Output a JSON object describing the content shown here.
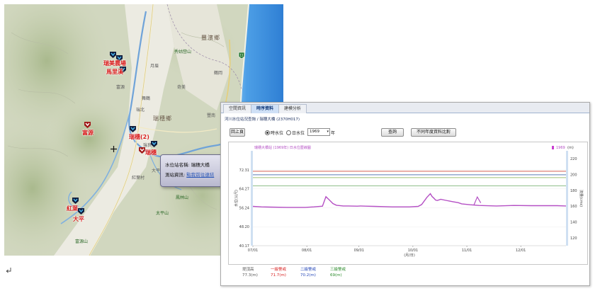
{
  "map": {
    "place_labels": [
      "豐濱鄉",
      "瑞穗鄉",
      "秀姑巒山",
      "月眉",
      "奇美",
      "紅葉村",
      "舞鶴",
      "瑞北",
      "富源",
      "大平",
      "鶴岡",
      "瑞良",
      "鳳林山",
      "太平山",
      "富源山",
      "豐南"
    ],
    "stations": [
      {
        "label": "瑞美農場",
        "name": "station-ruimei"
      },
      {
        "label": "馬里溪",
        "name": "station-mali"
      },
      {
        "label": "富源",
        "name": "station-fuyuan"
      },
      {
        "label": "瑞穗(2)",
        "name": "station-ruisui2"
      },
      {
        "label": "瑞穗",
        "name": "station-ruisui"
      },
      {
        "label": "紅葉",
        "name": "station-hongye"
      },
      {
        "label": "大平",
        "name": "station-daping"
      }
    ],
    "popup": {
      "station_label": "水位站名稱:",
      "station_value": "瑞穗大橋",
      "info_label": "測站資訊:",
      "info_link": "點我前往連結"
    },
    "highway_number": "11"
  },
  "panel": {
    "tabs": [
      {
        "label": "空間資訊",
        "active": false
      },
      {
        "label": "時序資料",
        "active": true
      },
      {
        "label": "建模分析",
        "active": false
      }
    ],
    "title": "河川水位站況查詢 / 瑞穗大橋 (2370H017)",
    "controls": {
      "back_button": "回上頁",
      "radio_hourly": "時水位",
      "radio_daily": "日水位",
      "year_value": "1969",
      "year_unit": "年",
      "query_button": "查詢",
      "compare_button": "不同年度資料比對"
    }
  },
  "chart_data": {
    "type": "line",
    "series_label": "瑞穗大橋站 (1969年) 日水位歷線圖",
    "legend_label": "1969",
    "left_axis": {
      "label": "水位(公尺)",
      "ticks": [
        40.17,
        48.2,
        56.24,
        64.27,
        72.31
      ],
      "ylim": [
        40.17,
        80.34
      ]
    },
    "right_axis": {
      "label": "流量(cms)",
      "ticks": [
        120,
        140,
        160,
        180,
        200,
        220
      ],
      "ylim": [
        110,
        230
      ]
    },
    "corner_unit": "(m)",
    "x_tick_labels": [
      "07/01",
      "08/01",
      "09/01",
      "10/01",
      "11/01",
      "12/01"
    ],
    "xlabel": "(月/日)",
    "x_range_days": [
      0,
      180
    ],
    "thresholds": [
      {
        "name": "一級警戒",
        "value": 71.7,
        "color": "#e08a80"
      },
      {
        "name": "二級警戒",
        "value": 70.2,
        "color": "#8aa0c8"
      },
      {
        "name": "三級警戒",
        "value": 69.0,
        "color": "#b8d09a"
      }
    ],
    "baseline": {
      "value": 65.5,
      "color": "#8fbf8a"
    },
    "x": [
      0,
      5,
      10,
      20,
      30,
      35,
      40,
      42,
      44,
      46,
      48,
      52,
      55,
      60,
      62,
      65,
      70,
      80,
      90,
      95,
      97,
      100,
      102,
      103,
      104,
      105,
      106,
      108,
      110,
      112,
      115,
      118,
      120,
      125,
      130,
      140,
      150,
      160,
      170,
      175,
      180
    ],
    "y": [
      56.8,
      56.6,
      56.5,
      56.4,
      56.4,
      56.6,
      56.9,
      60.9,
      59.5,
      58.0,
      57.3,
      57.0,
      57.0,
      56.9,
      57.0,
      56.9,
      56.8,
      56.6,
      56.6,
      56.8,
      57.6,
      60.6,
      62.2,
      61.0,
      60.3,
      59.5,
      59.3,
      59.8,
      59.5,
      59.2,
      58.8,
      58.4,
      57.9,
      57.5,
      57.2,
      57.0,
      57.2,
      57.1,
      57.1,
      57.1,
      57.0
    ],
    "x_extra_markers": [
      {
        "x": 129,
        "y": 60.8
      }
    ],
    "legend_row": {
      "items": [
        {
          "label": "堤頂高",
          "value": "77.3(m)",
          "color": "#555555"
        },
        {
          "label": "一級警戒",
          "value": "71.7(m)",
          "color": "#d82020"
        },
        {
          "label": "二級警戒",
          "value": "70.2(m)",
          "color": "#2547b8"
        },
        {
          "label": "三級警戒",
          "value": "69(m)",
          "color": "#2a8a2a"
        }
      ]
    },
    "line_color": "#b44fc4"
  }
}
